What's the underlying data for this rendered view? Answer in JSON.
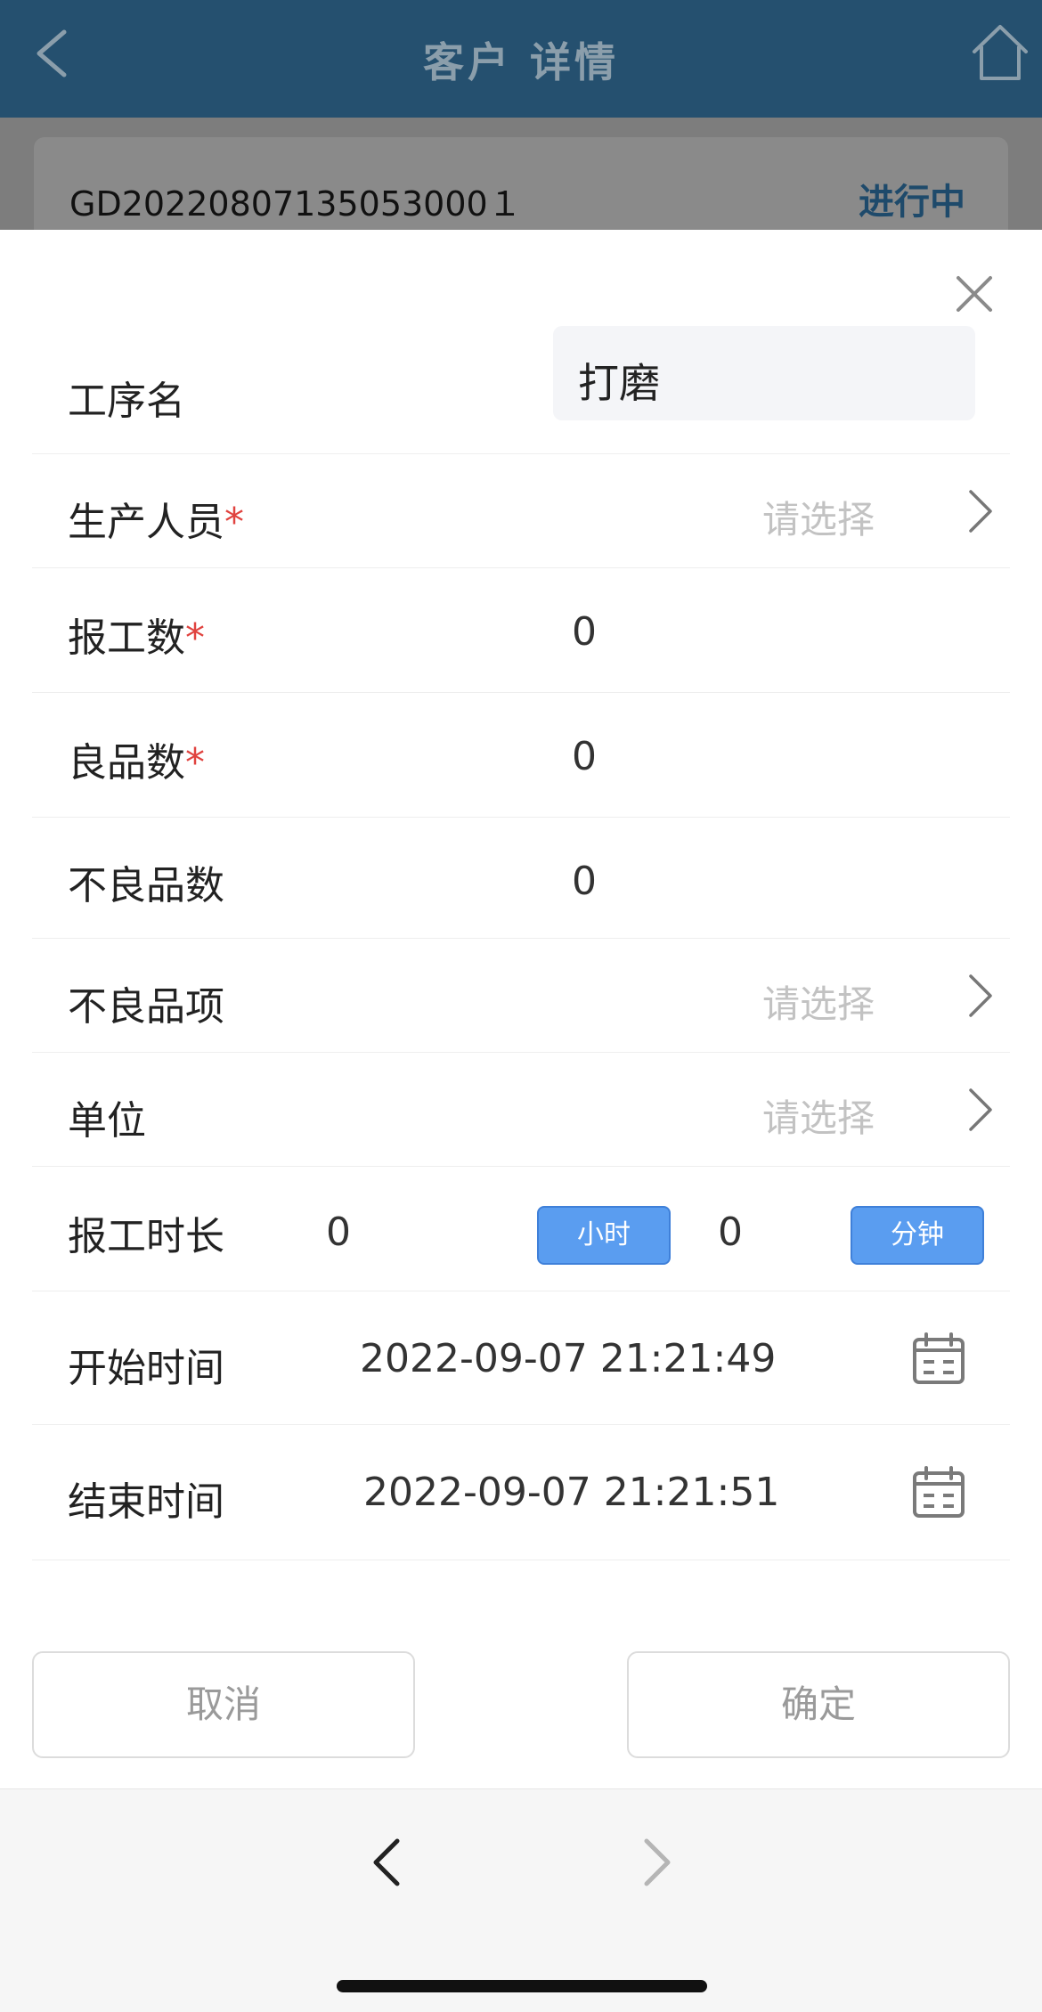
{
  "header": {
    "title": "客户 详情",
    "back_icon": "chevron-left-icon",
    "home_icon": "home-icon",
    "background_color": "#25506f"
  },
  "order": {
    "number": "GD20220807135053000１",
    "status": "进行中"
  },
  "form": {
    "process_name": {
      "label": "工序名",
      "value": "打磨"
    },
    "production_staff": {
      "label": "生产人员",
      "required_mark": "*",
      "placeholder": "请选择"
    },
    "reported_qty": {
      "label": "报工数",
      "required_mark": "*",
      "value": "0"
    },
    "good_qty": {
      "label": "良品数",
      "required_mark": "*",
      "value": "0"
    },
    "defect_qty": {
      "label": "不良品数",
      "value": "0"
    },
    "defect_items": {
      "label": "不良品项",
      "placeholder": "请选择"
    },
    "unit": {
      "label": "单位",
      "placeholder": "请选择"
    },
    "duration": {
      "label": "报工时长",
      "hours_value": "0",
      "hours_unit": "小时",
      "minutes_value": "0",
      "minutes_unit": "分钟"
    },
    "start_time": {
      "label": "开始时间",
      "value": "2022-09-07 21:21:49"
    },
    "end_time": {
      "label": "结束时间",
      "value": "2022-09-07 21:21:51"
    }
  },
  "actions": {
    "cancel_label": "取消",
    "confirm_label": "确定"
  },
  "colors": {
    "accent": "#5a9df0",
    "required": "#e0433f",
    "placeholder": "#c2c2c2"
  }
}
